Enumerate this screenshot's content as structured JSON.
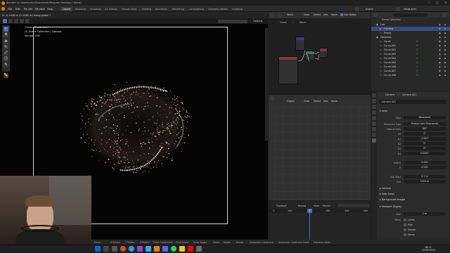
{
  "window": {
    "title": "Blender* [C:\\Users\\user\\Downloads\\Telegram Desktop\\7.blend]"
  },
  "menu": [
    "File",
    "Edit",
    "Render",
    "Window",
    "Help"
  ],
  "workspaces": [
    "Layout",
    "Modeling",
    "Sculpting",
    "UV Editing",
    "Texture Paint",
    "Shading",
    "Animation",
    "Rendering",
    "Compositing",
    "Geometry Nodes",
    "Scripting"
  ],
  "scene": {
    "scene_name": "Scene",
    "view_layer": "ViewLayer"
  },
  "viewport": {
    "header_text": "D: -0.1448 m (0.1448 m) along global Y",
    "options": "Options",
    "camera_title": "Camera Panoramic",
    "collection_path": "(1) Scene Collection | Camera",
    "sample": "Sample 3/32",
    "toolbar": [
      "select-icon",
      "cursor-icon",
      "move-icon",
      "rotate-icon",
      "scale-icon",
      "transform-icon",
      "annotate-icon",
      "measure-icon"
    ]
  },
  "node_editor": {
    "editor_type": "World",
    "menus": [
      "View",
      "Select",
      "Add",
      "Node"
    ],
    "use_nodes": "Use Nodes",
    "breadcrumb": [
      "Scene",
      "World"
    ]
  },
  "graph_editor": {
    "mode": "Object",
    "menus": [
      "View",
      "Select",
      "Add",
      "Node"
    ]
  },
  "timeline": {
    "menus": [
      "Playback",
      "Keying",
      "View",
      "Marker"
    ],
    "frames": [
      "1",
      "100",
      "200",
      "300",
      "400",
      "500",
      "600"
    ],
    "current_frame": "1"
  },
  "outliner": {
    "root": "Scene Collection",
    "items": [
      {
        "name": "Lab",
        "depth": 1,
        "icon": "collection",
        "selected": false
      },
      {
        "name": "Camera",
        "depth": 2,
        "icon": "camera",
        "selected": true
      },
      {
        "name": "Empty",
        "depth": 2,
        "icon": "empty",
        "selected": false
      },
      {
        "name": "Collection",
        "depth": 1,
        "icon": "collection",
        "selected": false
      },
      {
        "name": "Curve",
        "depth": 2,
        "icon": "curve",
        "selected": false
      },
      {
        "name": "Curve.001",
        "depth": 2,
        "icon": "curve",
        "selected": false
      },
      {
        "name": "Curve.002",
        "depth": 2,
        "icon": "curve",
        "selected": false
      },
      {
        "name": "Curve.003",
        "depth": 2,
        "icon": "curve",
        "selected": false
      },
      {
        "name": "Curve.004",
        "depth": 2,
        "icon": "curve",
        "selected": false
      },
      {
        "name": "Curve.005",
        "depth": 2,
        "icon": "curve",
        "selected": false
      },
      {
        "name": "Curve.006",
        "depth": 2,
        "icon": "curve",
        "selected": false
      },
      {
        "name": "Curve.007",
        "depth": 2,
        "icon": "curve",
        "selected": false
      },
      {
        "name": "Curve.008",
        "depth": 2,
        "icon": "curve",
        "selected": false
      }
    ]
  },
  "properties": {
    "breadcrumb": [
      "Camera",
      "Camera.001"
    ],
    "data_name": "Camera.001",
    "lens_section": "Lens",
    "fields": [
      {
        "label": "Type",
        "value": "Panoramic"
      },
      {
        "label": "Panorama Type",
        "value": "Fisheye Lens Polynomial"
      },
      {
        "label": "Field of View",
        "value": "180°"
      },
      {
        "label": "K0",
        "value": "0°"
      },
      {
        "label": "K1",
        "value": "-1.083°"
      },
      {
        "label": "K2",
        "value": "0°"
      },
      {
        "label": "K3",
        "value": "0°"
      },
      {
        "label": "K4",
        "value": "0.0001°"
      },
      {
        "label": "Shift X",
        "value": "0.000"
      },
      {
        "label": "Y",
        "value": "0.000"
      },
      {
        "label": "Clip Start",
        "value": "0.1 m"
      },
      {
        "label": "End",
        "value": "1000 m"
      }
    ],
    "sections": [
      "Camera",
      "Safe Areas",
      "Background Images",
      "Viewport Display"
    ],
    "viewport_display": {
      "size_label": "Size",
      "size_value": "1 m",
      "show_label": "Show",
      "checks": [
        "Limits",
        "Mist",
        "Sensor",
        "Name"
      ]
    }
  },
  "statusbar": [
    "Move",
    "X Rotate",
    "Y Rotate",
    "Z Rotate",
    "Clear Constraints",
    "Snap Invert",
    "Snap Toggle",
    "Move",
    "Rotate",
    "Resize",
    "Automatic Constraint",
    "Automatic Constraint Plane",
    "Precision Mode"
  ],
  "taskbar": {
    "time": "18:11",
    "date": "13.06.2023"
  },
  "colors": {
    "accent": "#4772b3",
    "selected_row": "#334d80",
    "header": "#2b2b2b",
    "playhead": "#4772b3"
  }
}
